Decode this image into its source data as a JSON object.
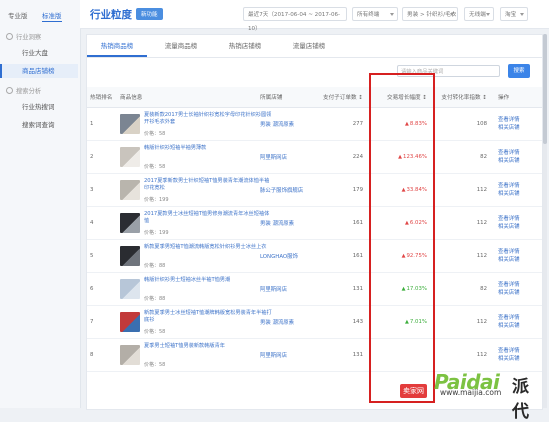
{
  "topmenu": [
    "专业版",
    "标准版"
  ],
  "sidebar": {
    "groups": [
      {
        "label": "行业洞察",
        "items": [
          "行业大盘",
          "商品店铺榜"
        ]
      },
      {
        "label": "搜索分析",
        "items": [
          "行业热搜词",
          "搜索词查询"
        ]
      }
    ],
    "active_item": "商品店铺榜"
  },
  "header": {
    "title": "行业粒度",
    "badge": "新功能",
    "date_range": "最近7天（2017-06-04 ~ 2017-06-10）",
    "device_select": "所有终端",
    "category_select": "男装 > 针织衫/毛衣",
    "extra_select": "无线端",
    "platform_select": "淘宝"
  },
  "tabs": [
    "热销商品榜",
    "流量商品榜",
    "热销店铺榜",
    "流量店铺榜"
  ],
  "search": {
    "placeholder": "请输入商品关键词",
    "button": "搜索"
  },
  "table": {
    "headers": [
      "热销排名",
      "商品信息",
      "所属店铺",
      "支付子订单数 ↕",
      "交易增长幅度 ↕",
      "支付转化率指数 ↕",
      "操作"
    ],
    "rows": [
      {
        "rank": "1",
        "title": "夏装新款2017男士长袖针织衫宽松字母印花针织衫圆领开衫毛衣外套",
        "price": "价格：58",
        "shop": "男装 潮流原素",
        "orders": "277",
        "growth": "8.83%",
        "growth_dir": "up",
        "conv": "108",
        "thumb_colors": [
          "#7b8592",
          "#d9d2c6"
        ]
      },
      {
        "rank": "2",
        "title": "韩版针织衫短袖半袖男薄款",
        "price": "价格：58",
        "shop": "阿里斯网店",
        "orders": "224",
        "growth": "123.46%",
        "growth_dir": "up",
        "conv": "82",
        "thumb_colors": [
          "#c9c4bd",
          "#efece8"
        ]
      },
      {
        "rank": "3",
        "title": "2017夏季新款男士针织短袖T恤男装青年潮流体恤半袖印花宽松",
        "price": "价格：199",
        "shop": "脉公子服饰旗舰店",
        "orders": "179",
        "growth": "33.84%",
        "growth_dir": "up",
        "conv": "112",
        "thumb_colors": [
          "#b9b5ad",
          "#e7e3dc"
        ]
      },
      {
        "rank": "4",
        "title": "2017夏款男士冰丝短袖T恤男修身潮流青年冰丝短袖体恤",
        "price": "价格：199",
        "shop": "男装 潮流原素",
        "orders": "161",
        "growth": "6.02%",
        "growth_dir": "up",
        "conv": "112",
        "thumb_colors": [
          "#2b2d33",
          "#9aa0a8"
        ]
      },
      {
        "rank": "5",
        "title": "新款夏季男短袖T恤潮流韩版宽松针织衫男士冰丝上衣",
        "price": "价格：88",
        "shop": "LONGHAO服饰",
        "orders": "161",
        "growth": "92.75%",
        "growth_dir": "up",
        "conv": "112",
        "thumb_colors": [
          "#2a2c31",
          "#6f747c"
        ]
      },
      {
        "rank": "6",
        "title": "韩版针织衫男士短袖冰丝半袖T恤男潮",
        "price": "价格：88",
        "shop": "阿里斯网店",
        "orders": "131",
        "growth": "17.03%",
        "growth_dir": "up-green",
        "conv": "82",
        "thumb_colors": [
          "#b7c6d8",
          "#dde5ee"
        ]
      },
      {
        "rank": "7",
        "title": "新款夏季男士冰丝短袖T恤潮牌韩版宽松男装青年半袖打底衫",
        "price": "价格：58",
        "shop": "男装 潮流原素",
        "orders": "143",
        "growth": "7.01%",
        "growth_dir": "up-green",
        "conv": "112",
        "thumb_colors": [
          "#c23a3a",
          "#3a6fb0"
        ]
      },
      {
        "rank": "8",
        "title": "夏季男士短袖T恤男装新款韩版青年",
        "price": "价格：58",
        "shop": "阿里斯网店",
        "orders": "131",
        "growth": "",
        "growth_dir": "up",
        "conv": "112",
        "thumb_colors": [
          "#b3aea7",
          "#e2ddd6"
        ]
      }
    ],
    "ops": [
      "查看详情",
      "相关店铺"
    ]
  },
  "watermark": {
    "brand_en": "Paidai",
    "brand_cn": "派代",
    "site_badge": "卖家网",
    "site_url": "www.maijia.com"
  }
}
